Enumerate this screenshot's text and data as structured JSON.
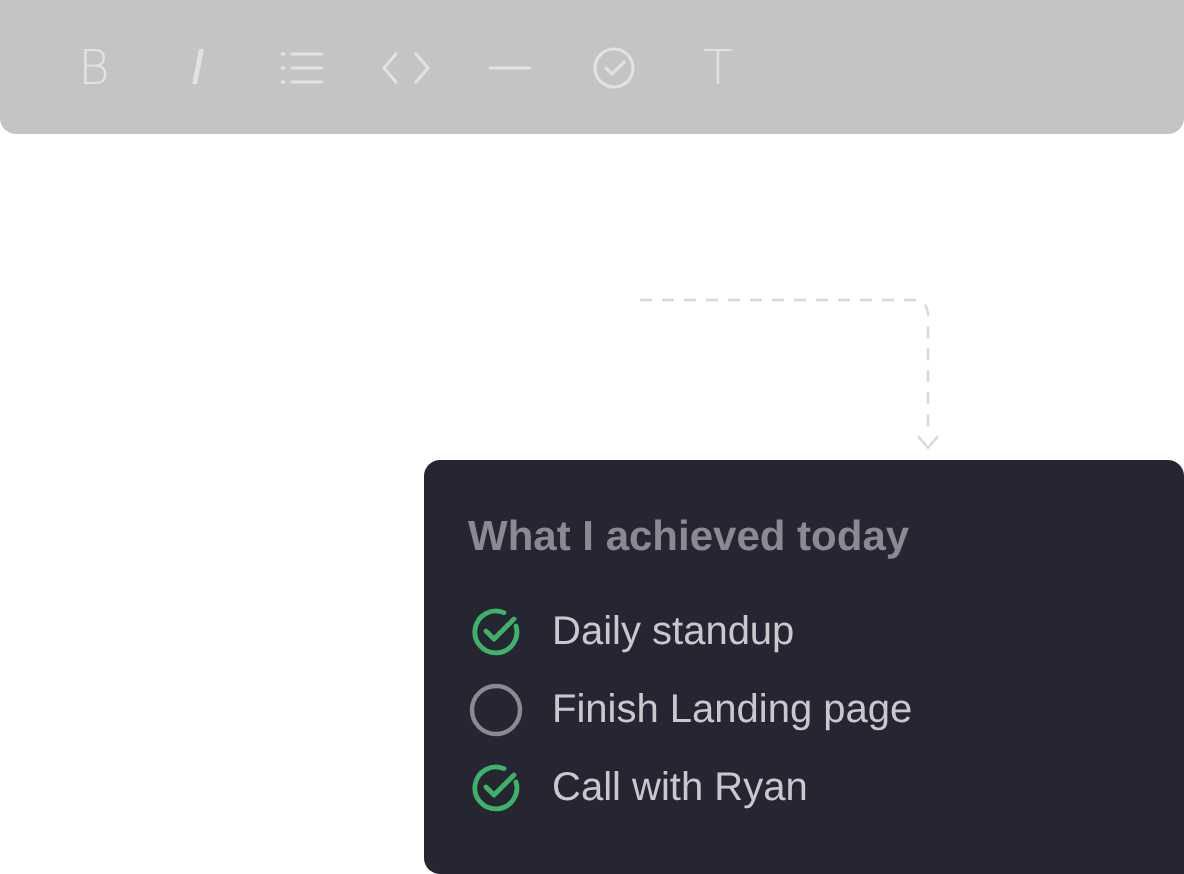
{
  "toolbar": {
    "buttons": [
      {
        "kind": "text",
        "label": "B"
      },
      {
        "kind": "text",
        "label": "I",
        "italic": true
      },
      {
        "kind": "list"
      },
      {
        "kind": "code"
      },
      {
        "kind": "rule"
      },
      {
        "kind": "check"
      },
      {
        "kind": "text",
        "label": "T"
      }
    ]
  },
  "card": {
    "title": "What I achieved today",
    "tasks": [
      {
        "label": "Daily standup",
        "checked": true
      },
      {
        "label": "Finish Landing page",
        "checked": false
      },
      {
        "label": "Call with Ryan",
        "checked": true
      }
    ]
  }
}
